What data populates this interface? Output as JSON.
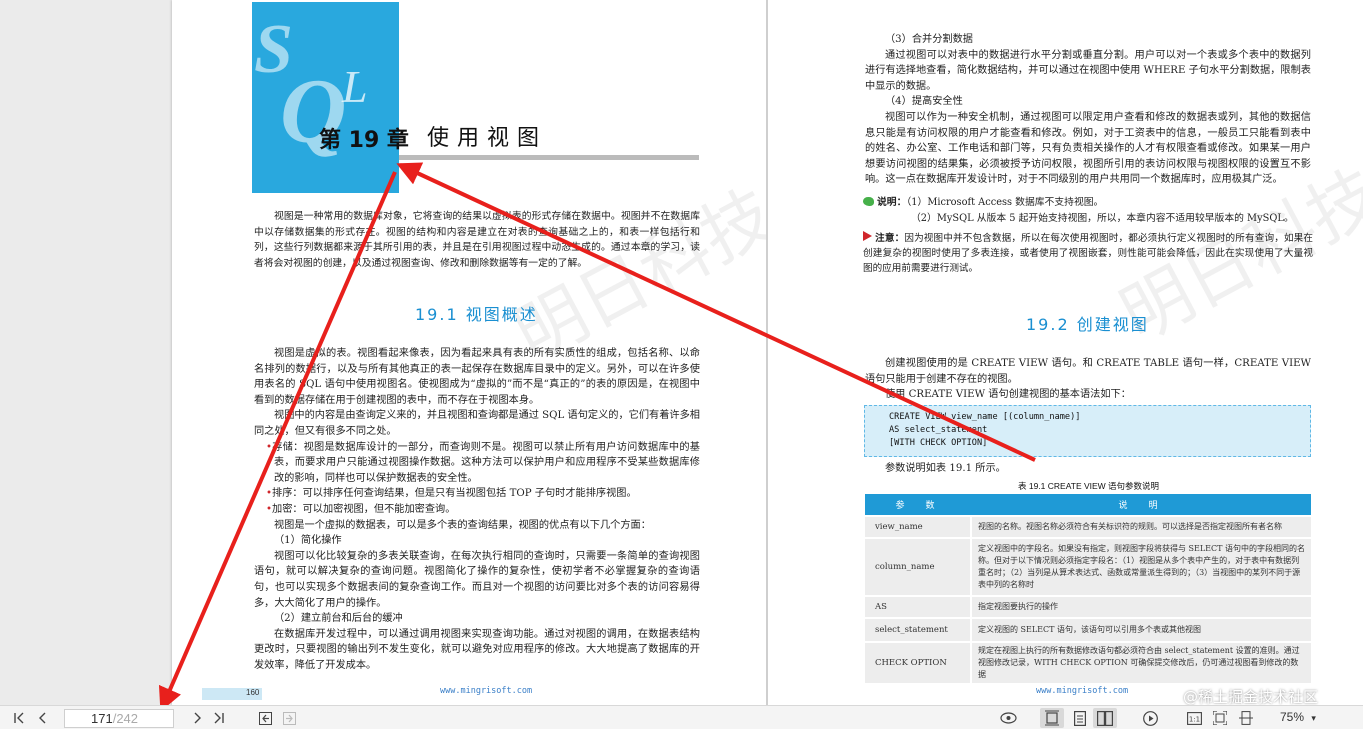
{
  "left_page": {
    "chapter_number": "第 19 章",
    "chapter_title": "使用视图",
    "logo_letters": {
      "s": "S",
      "q": "Q",
      "l": "L"
    },
    "intro": "视图是一种常用的数据库对象，它将查询的结果以虚拟表的形式存储在数据中。视图并不在数据库中以存储数据集的形式存在。视图的结构和内容是建立在对表的查询基础之上的，和表一样包括行和列，这些行列数据都来源于其所引用的表，并且是在引用视图过程中动态生成的。通过本章的学习，读者将会对视图的创建，以及通过视图查询、修改和删除数据等有一定的了解。",
    "section_title": "19.1  视图概述",
    "para1": "视图是虚拟的表。视图看起来像表，因为看起来具有表的所有实质性的组成，包括名称、以命名排列的数据行，以及与所有其他真正的表一起保存在数据库目录中的定义。另外，可以在许多使用表名的 SQL 语句中使用视图名。使视图成为“虚拟的”而不是“真正的”的表的原因是，在视图中看到的数据存储在用于创建视图的表中，而不存在于视图本身。",
    "para2": "视图中的内容是由查询定义来的，并且视图和查询都是通过 SQL 语句定义的，它们有着许多相同之处，但又有很多不同之处。",
    "bullets": [
      "存储：视图是数据库设计的一部分，而查询则不是。视图可以禁止所有用户访问数据库中的基表，而要求用户只能通过视图操作数据。这种方法可以保护用户和应用程序不受某些数据库修改的影响，同样也可以保护数据表的安全性。",
      "排序：可以排序任何查询结果，但是只有当视图包括 TOP 子句时才能排序视图。",
      "加密：可以加密视图，但不能加密查询。"
    ],
    "para3": "视图是一个虚拟的数据表，可以是多个表的查询结果，视图的优点有以下几个方面：",
    "sub1": "（1）简化操作",
    "para4": "视图可以化比较复杂的多表关联查询，在每次执行相同的查询时，只需要一条简单的查询视图语句，就可以解决复杂的查询问题。视图简化了操作的复杂性，使初学者不必掌握复杂的查询语句，也可以实现多个数据表间的复杂查询工作。而且对一个视图的访问要比对多个表的访问容易得多，大大简化了用户的操作。",
    "sub2": "（2）建立前台和后台的缓冲",
    "para5": "在数据库开发过程中，可以通过调用视图来实现查询功能。通过对视图的调用，在数据表结构更改时，只要视图的输出列不发生变化，就可以避免对应用程序的修改。大大地提高了数据库的开发效率，降低了开发成本。",
    "page_number": "160",
    "footer": "www.mingrisoft.com"
  },
  "right_page": {
    "sub3": "（3）合并分割数据",
    "para1": "通过视图可以对表中的数据进行水平分割或垂直分割。用户可以对一个表或多个表中的数据列进行有选择地查看，简化数据结构，并可以通过在视图中使用 WHERE 子句水平分割数据，限制表中显示的数据。",
    "sub4": "（4）提高安全性",
    "para2": "视图可以作为一种安全机制，通过视图可以限定用户查看和修改的数据表或列，其他的数据信息只能是有访问权限的用户才能查看和修改。例如，对于工资表中的信息，一般员工只能看到表中的姓名、办公室、工作电话和部门等，只有负责相关操作的人才有权限查看或修改。如果某一用户想要访问视图的结果集，必须被授予访问权限，视图所引用的表访问权限与视图权限的设置互不影响。这一点在数据库开发设计时，对于不同级别的用户共用同一个数据库时，应用极其广泛。",
    "note_label": "说明：",
    "note1": "（1）Microsoft Access 数据库不支持视图。",
    "note2": "（2）MySQL 从版本 5 起开始支持视图，所以，本章内容不适用较早版本的 MySQL。",
    "warn_label": "注意：",
    "warn_text": "因为视图中并不包含数据，所以在每次使用视图时，都必须执行定义视图时的所有查询，如果在创建复杂的视图时使用了多表连接，或者使用了视图嵌套，则性能可能会降低，因此在实现使用了大量视图的应用前需要进行测试。",
    "section_title": "19.2  创建视图",
    "para3": "创建视图使用的是 CREATE VIEW 语句。和 CREATE TABLE 语句一样，CREATE VIEW 语句只能用于创建不存在的视图。",
    "para4": "使用 CREATE VIEW 语句创建视图的基本语法如下：",
    "code": [
      "CREATE VIEW view_name [(column_name)]",
      "AS select_statement",
      "[WITH CHECK OPTION]"
    ],
    "para5": "参数说明如表 19.1 所示。",
    "table_caption": "表 19.1   CREATE VIEW 语句参数说明",
    "table_headers": [
      "参　数",
      "说　明"
    ],
    "table_rows": [
      {
        "param": "view_name",
        "desc": "视图的名称。视图名称必须符合有关标识符的规则。可以选择是否指定视图所有者名称"
      },
      {
        "param": "column_name",
        "desc": "定义视图中的字段名。如果没有指定，则视图字段将获得与 SELECT 语句中的字段相同的名称。但对于以下情况则必须指定字段名：（1）视图是从多个表中产生的，对于表中有数据列重名时；（2）当列是从算术表达式、函数或常量派生得到的；（3）当视图中的某列不同于源表中列的名称时"
      },
      {
        "param": "AS",
        "desc": "指定视图要执行的操作"
      },
      {
        "param": "select_statement",
        "desc": "定义视图的 SELECT 语句，该语句可以引用多个表或其他视图"
      },
      {
        "param": "CHECK OPTION",
        "desc": "规定在视图上执行的所有数据修改语句都必须符合由 select_statement 设置的准则。通过视图修改记录，WITH CHECK OPTION 可确保提交修改后，仍可通过视图看到修改的数据"
      }
    ],
    "footer": "www.mingrisoft.com"
  },
  "watermark": "明日科技",
  "credit": "@稀土掘金技术社区",
  "toolbar": {
    "current_page": "171",
    "total_pages": "/242",
    "zoom": "75%",
    "icons": [
      "first-page-icon",
      "prev-page-icon",
      "next-page-icon",
      "last-page-icon",
      "back-icon",
      "forward-icon",
      "read-mode-icon",
      "continuous-scroll-icon",
      "single-page-icon",
      "two-page-icon",
      "play-icon",
      "actual-size-icon",
      "fit-page-icon",
      "fit-width-icon",
      "zoom-dropdown-icon"
    ]
  },
  "colors": {
    "accent": "#29a8de",
    "arrow": "#e8201c",
    "bullet": "#d0262b",
    "heading": "#1a8fd1"
  }
}
